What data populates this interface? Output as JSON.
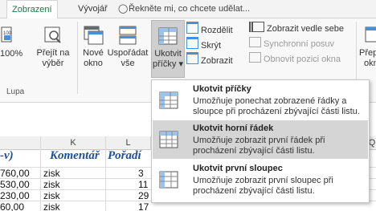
{
  "tabs": {
    "items": [
      "Zobrazení",
      "Vývojář"
    ],
    "active_index": 0,
    "tell_me": "Řekněte mi, co chcete udělat..."
  },
  "ribbon": {
    "zoom_100": "100%",
    "goto_selection": [
      "Přejít na",
      "výběr"
    ],
    "new_window": [
      "Nové",
      "okno"
    ],
    "arrange_all": [
      "Uspořádat",
      "vše"
    ],
    "freeze_panes": [
      "Ukotvit",
      "příčky"
    ],
    "split": "Rozdělit",
    "hide": "Skrýt",
    "unhide": "Zobrazit",
    "view_side_by_side": "Zobrazit vedle sebe",
    "synchronous_scrolling": "Synchronní posuv",
    "reset_window_position": "Obnovit pozici okna",
    "switch_windows": [
      "Přep",
      "okn"
    ],
    "group_zoom_label": "Lupa"
  },
  "sheet": {
    "columns": [
      "K",
      "L",
      "Q"
    ],
    "header_row": {
      "left_fragment": "-v)",
      "komentar": "Komentář",
      "poradi": "Pořadí"
    },
    "rows": [
      {
        "value": "760,00",
        "comment": "zisk",
        "rank": "3"
      },
      {
        "value": "530,00",
        "comment": "zisk",
        "rank": "11"
      },
      {
        "value": "230,00",
        "comment": "zisk",
        "rank": "29"
      },
      {
        "value": "60,00",
        "comment": "zisk",
        "rank": "17"
      }
    ]
  },
  "freeze_menu": {
    "items": [
      {
        "title": "Ukotvit příčky",
        "desc_1": "Umožňuje ponechat zobrazené řádky a",
        "desc_2": "sloupce při procházení zbývající části listu."
      },
      {
        "title": "Ukotvit horní řádek",
        "desc_1": "Umožňuje zobrazit první řádek při",
        "desc_2": "procházení zbývající části listu."
      },
      {
        "title": "Ukotvit první sloupec",
        "desc_1": "Umožňuje zobrazit první sloupec při",
        "desc_2": "procházení zbývající části listu."
      }
    ],
    "highlighted_index": 1
  },
  "colors": {
    "accent": "#217346",
    "header_text": "#1f4e9a",
    "highlight": "#d5d5d5"
  }
}
